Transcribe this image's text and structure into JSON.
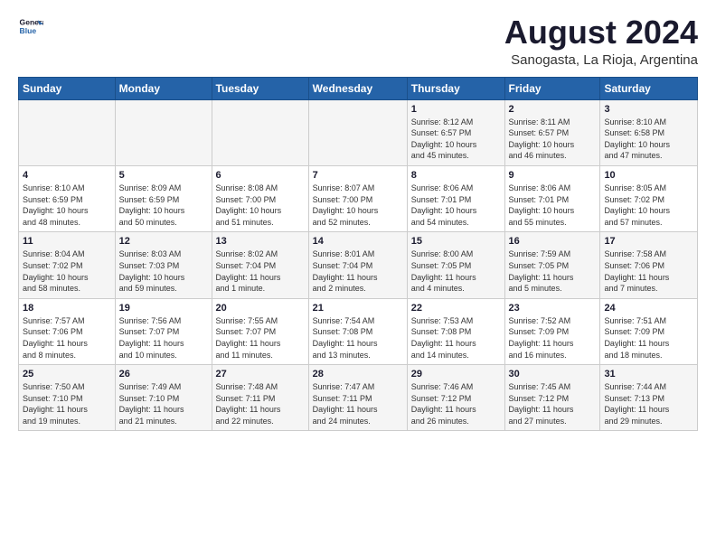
{
  "header": {
    "logo_line1": "General",
    "logo_line2": "Blue",
    "main_title": "August 2024",
    "subtitle": "Sanogasta, La Rioja, Argentina"
  },
  "days_of_week": [
    "Sunday",
    "Monday",
    "Tuesday",
    "Wednesday",
    "Thursday",
    "Friday",
    "Saturday"
  ],
  "weeks": [
    [
      {
        "day": "",
        "info": ""
      },
      {
        "day": "",
        "info": ""
      },
      {
        "day": "",
        "info": ""
      },
      {
        "day": "",
        "info": ""
      },
      {
        "day": "1",
        "info": "Sunrise: 8:12 AM\nSunset: 6:57 PM\nDaylight: 10 hours\nand 45 minutes."
      },
      {
        "day": "2",
        "info": "Sunrise: 8:11 AM\nSunset: 6:57 PM\nDaylight: 10 hours\nand 46 minutes."
      },
      {
        "day": "3",
        "info": "Sunrise: 8:10 AM\nSunset: 6:58 PM\nDaylight: 10 hours\nand 47 minutes."
      }
    ],
    [
      {
        "day": "4",
        "info": "Sunrise: 8:10 AM\nSunset: 6:59 PM\nDaylight: 10 hours\nand 48 minutes."
      },
      {
        "day": "5",
        "info": "Sunrise: 8:09 AM\nSunset: 6:59 PM\nDaylight: 10 hours\nand 50 minutes."
      },
      {
        "day": "6",
        "info": "Sunrise: 8:08 AM\nSunset: 7:00 PM\nDaylight: 10 hours\nand 51 minutes."
      },
      {
        "day": "7",
        "info": "Sunrise: 8:07 AM\nSunset: 7:00 PM\nDaylight: 10 hours\nand 52 minutes."
      },
      {
        "day": "8",
        "info": "Sunrise: 8:06 AM\nSunset: 7:01 PM\nDaylight: 10 hours\nand 54 minutes."
      },
      {
        "day": "9",
        "info": "Sunrise: 8:06 AM\nSunset: 7:01 PM\nDaylight: 10 hours\nand 55 minutes."
      },
      {
        "day": "10",
        "info": "Sunrise: 8:05 AM\nSunset: 7:02 PM\nDaylight: 10 hours\nand 57 minutes."
      }
    ],
    [
      {
        "day": "11",
        "info": "Sunrise: 8:04 AM\nSunset: 7:02 PM\nDaylight: 10 hours\nand 58 minutes."
      },
      {
        "day": "12",
        "info": "Sunrise: 8:03 AM\nSunset: 7:03 PM\nDaylight: 10 hours\nand 59 minutes."
      },
      {
        "day": "13",
        "info": "Sunrise: 8:02 AM\nSunset: 7:04 PM\nDaylight: 11 hours\nand 1 minute."
      },
      {
        "day": "14",
        "info": "Sunrise: 8:01 AM\nSunset: 7:04 PM\nDaylight: 11 hours\nand 2 minutes."
      },
      {
        "day": "15",
        "info": "Sunrise: 8:00 AM\nSunset: 7:05 PM\nDaylight: 11 hours\nand 4 minutes."
      },
      {
        "day": "16",
        "info": "Sunrise: 7:59 AM\nSunset: 7:05 PM\nDaylight: 11 hours\nand 5 minutes."
      },
      {
        "day": "17",
        "info": "Sunrise: 7:58 AM\nSunset: 7:06 PM\nDaylight: 11 hours\nand 7 minutes."
      }
    ],
    [
      {
        "day": "18",
        "info": "Sunrise: 7:57 AM\nSunset: 7:06 PM\nDaylight: 11 hours\nand 8 minutes."
      },
      {
        "day": "19",
        "info": "Sunrise: 7:56 AM\nSunset: 7:07 PM\nDaylight: 11 hours\nand 10 minutes."
      },
      {
        "day": "20",
        "info": "Sunrise: 7:55 AM\nSunset: 7:07 PM\nDaylight: 11 hours\nand 11 minutes."
      },
      {
        "day": "21",
        "info": "Sunrise: 7:54 AM\nSunset: 7:08 PM\nDaylight: 11 hours\nand 13 minutes."
      },
      {
        "day": "22",
        "info": "Sunrise: 7:53 AM\nSunset: 7:08 PM\nDaylight: 11 hours\nand 14 minutes."
      },
      {
        "day": "23",
        "info": "Sunrise: 7:52 AM\nSunset: 7:09 PM\nDaylight: 11 hours\nand 16 minutes."
      },
      {
        "day": "24",
        "info": "Sunrise: 7:51 AM\nSunset: 7:09 PM\nDaylight: 11 hours\nand 18 minutes."
      }
    ],
    [
      {
        "day": "25",
        "info": "Sunrise: 7:50 AM\nSunset: 7:10 PM\nDaylight: 11 hours\nand 19 minutes."
      },
      {
        "day": "26",
        "info": "Sunrise: 7:49 AM\nSunset: 7:10 PM\nDaylight: 11 hours\nand 21 minutes."
      },
      {
        "day": "27",
        "info": "Sunrise: 7:48 AM\nSunset: 7:11 PM\nDaylight: 11 hours\nand 22 minutes."
      },
      {
        "day": "28",
        "info": "Sunrise: 7:47 AM\nSunset: 7:11 PM\nDaylight: 11 hours\nand 24 minutes."
      },
      {
        "day": "29",
        "info": "Sunrise: 7:46 AM\nSunset: 7:12 PM\nDaylight: 11 hours\nand 26 minutes."
      },
      {
        "day": "30",
        "info": "Sunrise: 7:45 AM\nSunset: 7:12 PM\nDaylight: 11 hours\nand 27 minutes."
      },
      {
        "day": "31",
        "info": "Sunrise: 7:44 AM\nSunset: 7:13 PM\nDaylight: 11 hours\nand 29 minutes."
      }
    ]
  ]
}
